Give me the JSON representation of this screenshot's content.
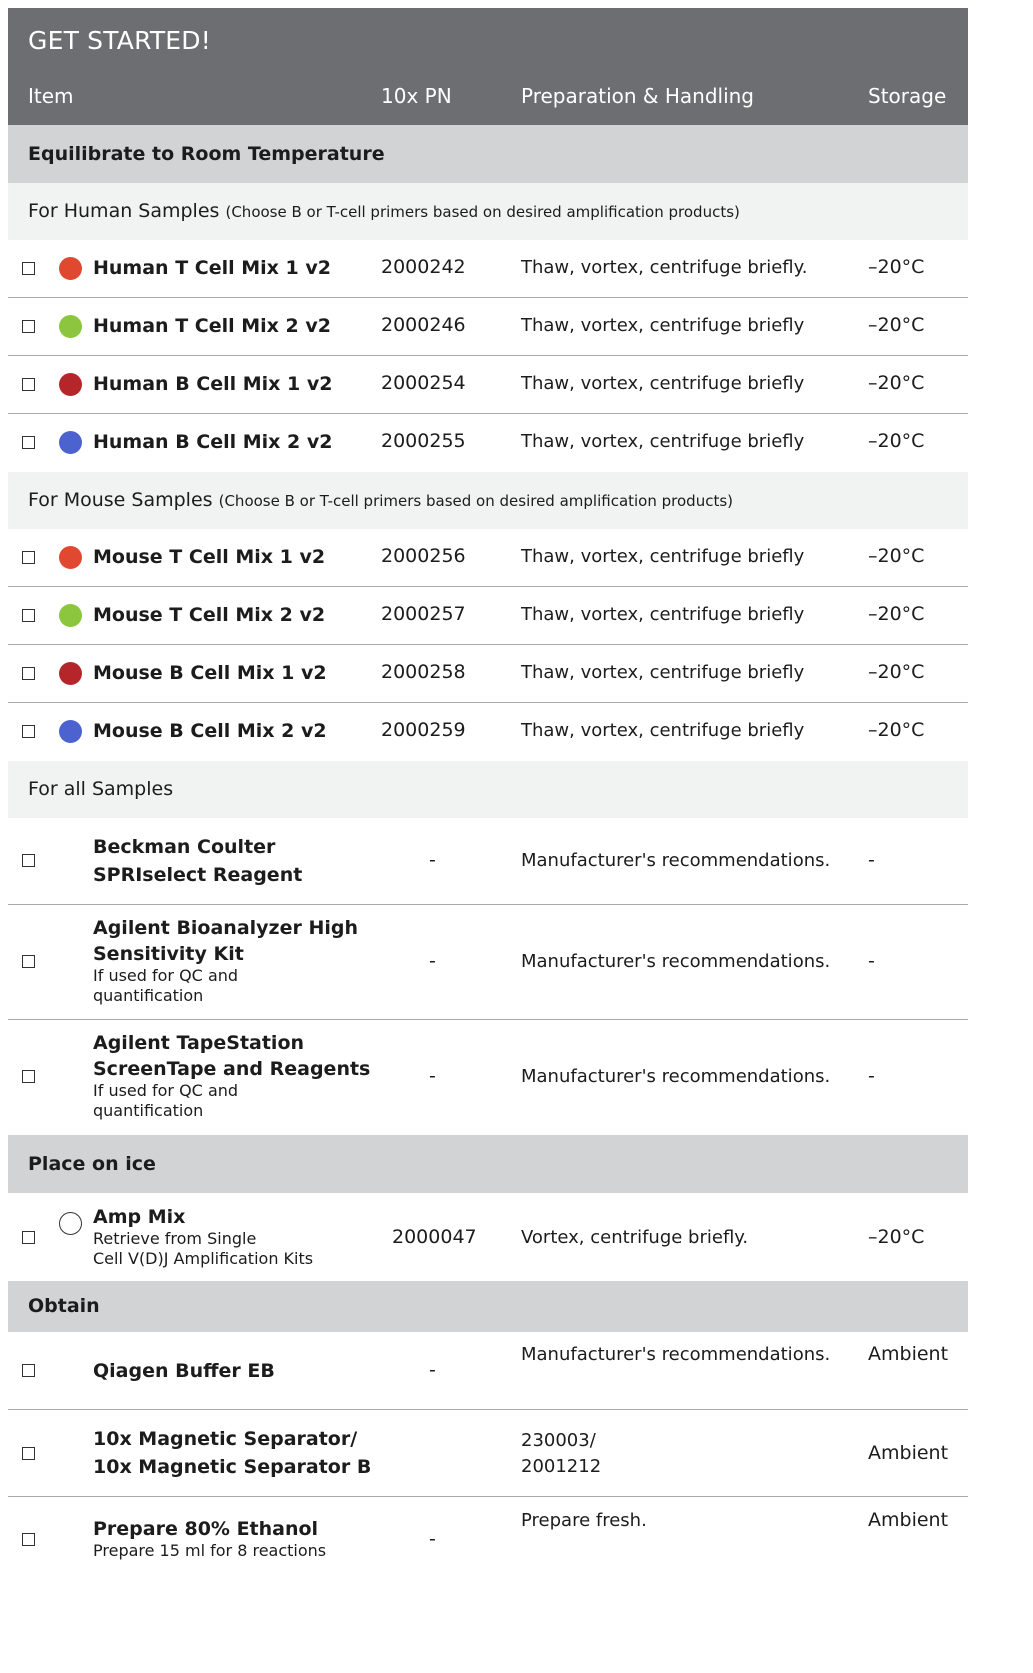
{
  "title": "GET STARTED!",
  "columns": {
    "item": "Item",
    "pn": "10x PN",
    "prep": "Preparation & Handling",
    "storage": "Storage"
  },
  "colors": {
    "header_bg": "#6d6e71",
    "section_bg": "#d1d3d4",
    "subsection_bg": "#f1f2f2",
    "orange_red": "#e0492f",
    "green": "#8cc63f",
    "dark_red": "#b5262b",
    "blue": "#4b62cf"
  },
  "sections": [
    {
      "label": "Equilibrate to Room Temperature"
    },
    {
      "label": "For all Samples"
    },
    {
      "label": "Place on ice"
    },
    {
      "label": "Obtain"
    }
  ],
  "subsections": [
    {
      "label": "For Human Samples",
      "note": "(Choose B or T-cell primers based on desired amplification products)"
    },
    {
      "label": "For Mouse Samples",
      "note": "(Choose B or T-cell primers based on desired amplification products)"
    }
  ],
  "rows": [
    {
      "item": "Human T Cell Mix 1 v2",
      "pn": "2000242",
      "prep": "Thaw, vortex, centrifuge briefly.",
      "storage": "–20°C",
      "color": "orange_red"
    },
    {
      "item": "Human T Cell Mix 2 v2",
      "pn": "2000246",
      "prep": "Thaw, vortex, centrifuge briefly",
      "storage": "–20°C",
      "color": "green"
    },
    {
      "item": "Human B Cell Mix 1 v2",
      "pn": "2000254",
      "prep": "Thaw, vortex, centrifuge briefly",
      "storage": "–20°C",
      "color": "dark_red"
    },
    {
      "item": "Human B Cell Mix 2 v2",
      "pn": "2000255",
      "prep": "Thaw, vortex, centrifuge briefly",
      "storage": "–20°C",
      "color": "blue"
    },
    {
      "item": "Mouse T Cell Mix 1 v2",
      "pn": "2000256",
      "prep": "Thaw, vortex, centrifuge briefly",
      "storage": "–20°C",
      "color": "orange_red"
    },
    {
      "item": "Mouse T Cell Mix 2 v2",
      "pn": "2000257",
      "prep": "Thaw, vortex, centrifuge briefly",
      "storage": "–20°C",
      "color": "green"
    },
    {
      "item": "Mouse B Cell Mix 1 v2",
      "pn": "2000258",
      "prep": "Thaw, vortex, centrifuge briefly",
      "storage": "–20°C",
      "color": "dark_red"
    },
    {
      "item": "Mouse B Cell Mix 2 v2",
      "pn": "2000259",
      "prep": "Thaw, vortex, centrifuge briefly",
      "storage": "–20°C",
      "color": "blue"
    },
    {
      "item_line1": "Beckman Coulter",
      "item_line2": "SPRIselect Reagent",
      "pn": "-",
      "prep": "Manufacturer's recommendations.",
      "storage": "-"
    },
    {
      "item_line1": "Agilent Bioanalyzer High",
      "item_line2": "Sensitivity Kit",
      "sub_line1": "If used for QC and",
      "sub_line2": "quantification",
      "pn": "-",
      "prep": "Manufacturer's recommendations.",
      "storage": "-"
    },
    {
      "item_line1": "Agilent TapeStation",
      "item_line2": "ScreenTape and Reagents",
      "sub_line1": "If used for QC and",
      "sub_line2": "quantification",
      "pn": "-",
      "prep": "Manufacturer's recommendations.",
      "storage": "-"
    },
    {
      "item": "Amp Mix",
      "sub_line1": "Retrieve from Single",
      "sub_line2": "Cell V(D)J Amplification Kits",
      "pn": "2000047",
      "prep": "Vortex, centrifuge briefly.",
      "storage": "–20°C"
    },
    {
      "item": "Qiagen Buffer EB",
      "pn": "-",
      "prep": "Manufacturer's recommendations.",
      "storage": "Ambient"
    },
    {
      "item_line1": "10x Magnetic Separator/",
      "item_line2": "10x Magnetic Separator B",
      "prep_line1": "230003/",
      "prep_line2": "2001212",
      "storage": "Ambient"
    },
    {
      "item": "Prepare 80% Ethanol",
      "sub": "Prepare 15 ml for 8 reactions",
      "pn": "-",
      "prep": "Prepare fresh.",
      "storage": "Ambient"
    }
  ]
}
